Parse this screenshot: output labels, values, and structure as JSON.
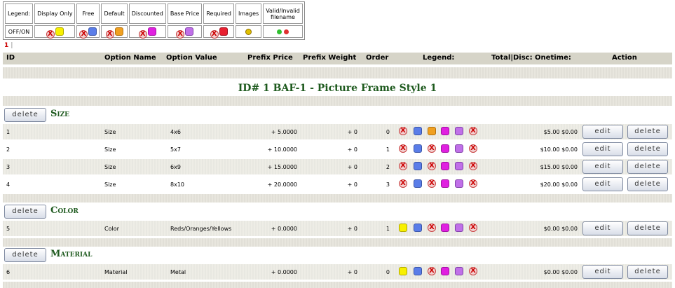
{
  "legend": {
    "headers": [
      "Legend:",
      "Display Only",
      "Free",
      "Default",
      "Discounted",
      "Base Price",
      "Required",
      "Images",
      "Valid/Invalid filename"
    ],
    "row_label": "OFF/ON"
  },
  "pager": {
    "page": "1",
    "sep": "|"
  },
  "columns": {
    "id": "ID",
    "option_name": "Option Name",
    "option_value": "Option Value",
    "prefix_price": "Prefix Price",
    "prefix_weight": "Prefix Weight",
    "order": "Order",
    "legend": "Legend:",
    "total": "Total|Disc: Onetime:",
    "action": "Action"
  },
  "product_title": "ID# 1 BAF-1 - Picture Frame Style 1",
  "buttons": {
    "delete": "delete",
    "edit": "edit"
  },
  "sections": [
    {
      "name": "Size"
    },
    {
      "name": "Color"
    },
    {
      "name": "Material"
    }
  ],
  "rows": [
    {
      "id": "1",
      "name": "Size",
      "value": "4x6",
      "price": "+ 5.0000",
      "weight": "+ 0",
      "order": "0",
      "total": "$5.00 $0.00",
      "icons": [
        "x",
        "blue",
        "orange",
        "magenta",
        "purple",
        "x"
      ]
    },
    {
      "id": "2",
      "name": "Size",
      "value": "5x7",
      "price": "+ 10.0000",
      "weight": "+ 0",
      "order": "1",
      "total": "$10.00 $0.00",
      "icons": [
        "x",
        "blue",
        "x",
        "magenta",
        "purple",
        "x"
      ]
    },
    {
      "id": "3",
      "name": "Size",
      "value": "6x9",
      "price": "+ 15.0000",
      "weight": "+ 0",
      "order": "2",
      "total": "$15.00 $0.00",
      "icons": [
        "x",
        "blue",
        "x",
        "magenta",
        "purple",
        "x"
      ]
    },
    {
      "id": "4",
      "name": "Size",
      "value": "8x10",
      "price": "+ 20.0000",
      "weight": "+ 0",
      "order": "3",
      "total": "$20.00 $0.00",
      "icons": [
        "x",
        "blue",
        "x",
        "magenta",
        "purple",
        "x"
      ]
    },
    {
      "id": "5",
      "name": "Color",
      "value": "Reds/Oranges/Yellows",
      "price": "+ 0.0000",
      "weight": "+ 0",
      "order": "1",
      "total": "$0.00 $0.00",
      "icons": [
        "yellow",
        "blue",
        "x",
        "magenta",
        "purple",
        "x"
      ]
    },
    {
      "id": "6",
      "name": "Material",
      "value": "Metal",
      "price": "+ 0.0000",
      "weight": "+ 0",
      "order": "0",
      "total": "$0.00 $0.00",
      "icons": [
        "yellow",
        "blue",
        "x",
        "magenta",
        "purple",
        "x"
      ]
    }
  ],
  "colors": {
    "accent_green": "#1e5a1e",
    "pager_red": "#cc0000"
  }
}
